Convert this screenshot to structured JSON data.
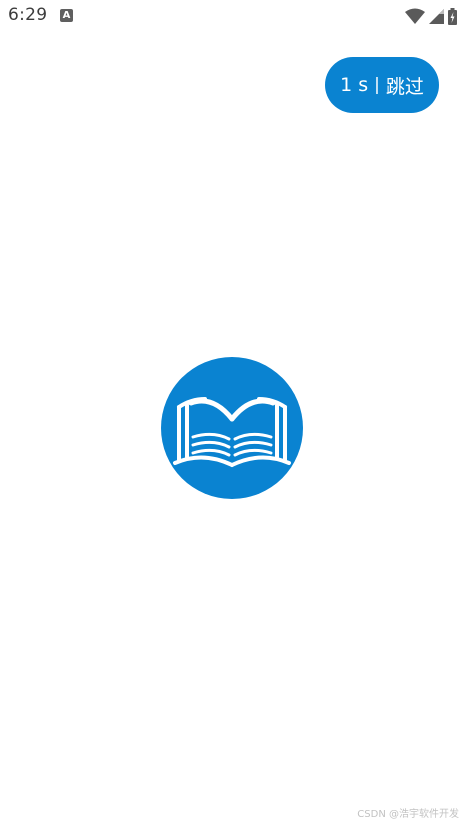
{
  "status_bar": {
    "time": "6:29",
    "notification_icon": "A",
    "icons": [
      "wifi-icon",
      "cellular-signal-icon",
      "battery-charging-icon"
    ]
  },
  "splash": {
    "skip_seconds": "1 s",
    "skip_separator": "|",
    "skip_label": "跳过",
    "logo_icon": "open-book-icon",
    "accent_color": "#0a83d1"
  },
  "watermark": {
    "text": "CSDN @浩宇软件开发"
  }
}
